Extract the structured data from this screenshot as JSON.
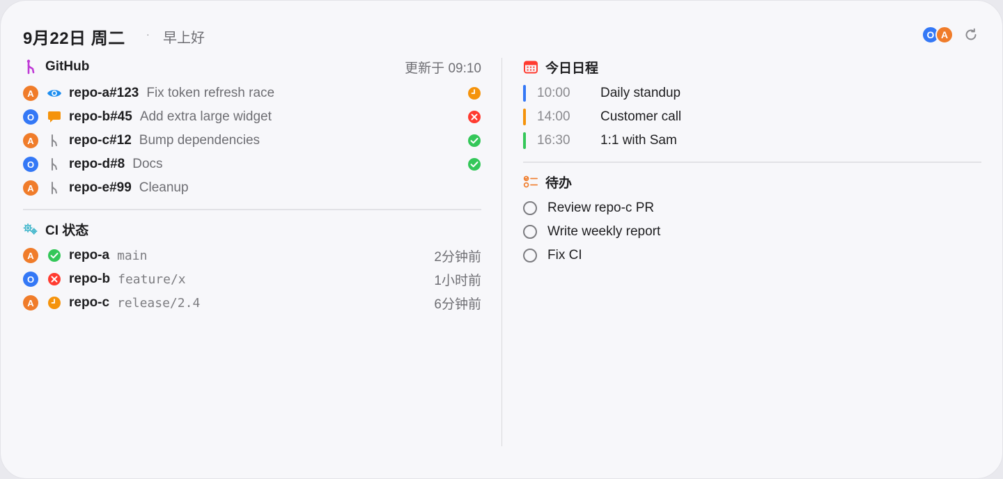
{
  "header": {
    "date": "9月22日 周二",
    "separator": "·",
    "greeting": "早上好",
    "accounts": [
      {
        "initial": "O",
        "color": "#3478f6"
      },
      {
        "initial": "A",
        "color": "#f07c2a"
      }
    ],
    "refresh_icon": "refresh-icon"
  },
  "github": {
    "title": "GitHub",
    "updated": "更新于 09:10",
    "icon": "branch-icon",
    "items": [
      {
        "account": "A",
        "icon": "eye-icon",
        "repo": "repo-a#123",
        "title": "Fix token refresh race",
        "status": "pending"
      },
      {
        "account": "O",
        "icon": "comment-icon",
        "repo": "repo-b#45",
        "title": "Add extra large widget",
        "status": "failed"
      },
      {
        "account": "A",
        "icon": "branch-icon",
        "repo": "repo-c#12",
        "title": "Bump dependencies",
        "status": "success"
      },
      {
        "account": "O",
        "icon": "branch-icon",
        "repo": "repo-d#8",
        "title": "Docs",
        "status": "success"
      },
      {
        "account": "A",
        "icon": "branch-icon",
        "repo": "repo-e#99",
        "title": "Cleanup",
        "status": "none"
      }
    ]
  },
  "ci": {
    "title": "CI 状态",
    "icon": "gears-icon",
    "items": [
      {
        "account": "A",
        "status": "success",
        "repo": "repo-a",
        "branch": "main",
        "when": "2分钟前"
      },
      {
        "account": "O",
        "status": "failed",
        "repo": "repo-b",
        "branch": "feature/x",
        "when": "1小时前"
      },
      {
        "account": "A",
        "status": "pending",
        "repo": "repo-c",
        "branch": "release/2.4",
        "when": "6分钟前"
      }
    ]
  },
  "schedule": {
    "title": "今日日程",
    "icon": "calendar-icon",
    "events": [
      {
        "time": "10:00",
        "title": "Daily standup",
        "color": "#3478f6"
      },
      {
        "time": "14:00",
        "title": "Customer call",
        "color": "#f5930b"
      },
      {
        "time": "16:30",
        "title": "1:1 with Sam",
        "color": "#34c759"
      }
    ]
  },
  "todo": {
    "title": "待办",
    "icon": "checklist-icon",
    "items": [
      {
        "title": "Review repo-c PR"
      },
      {
        "title": "Write weekly report"
      },
      {
        "title": "Fix CI"
      }
    ]
  },
  "colors": {
    "success": "#34c759",
    "failed": "#ff3b30",
    "pending": "#f5930b",
    "github_accent": "#bf3ad6",
    "ci_accent": "#30b0c7",
    "calendar_accent": "#ff3b30"
  }
}
